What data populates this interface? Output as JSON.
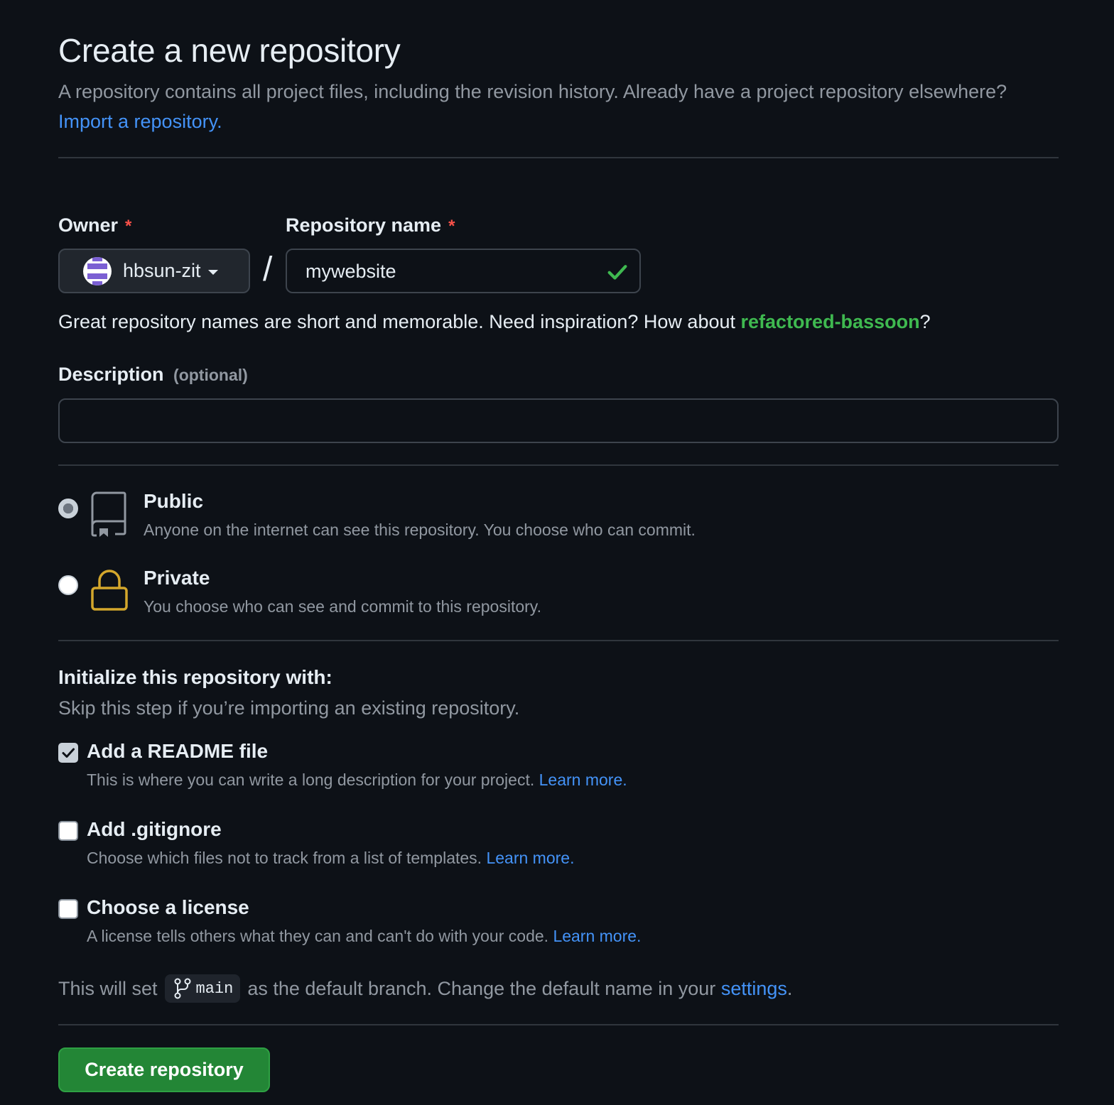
{
  "header": {
    "title": "Create a new repository",
    "intro": "A repository contains all project files, including the revision history. Already have a project repository elsewhere?",
    "import_link": "Import a repository."
  },
  "owner": {
    "label": "Owner",
    "required_mark": "*",
    "value": "hbsun-zit"
  },
  "repo_name": {
    "label": "Repository name",
    "required_mark": "*",
    "separator": "/",
    "value": "mywebsite",
    "hint_prefix": "Great repository names are short and memorable. Need inspiration? How about",
    "suggestion": "refactored-bassoon",
    "hint_suffix": "?"
  },
  "description": {
    "label": "Description",
    "optional": "(optional)",
    "value": ""
  },
  "visibility": {
    "public": {
      "title": "Public",
      "desc": "Anyone on the internet can see this repository. You choose who can commit.",
      "selected": true
    },
    "private": {
      "title": "Private",
      "desc": "You choose who can see and commit to this repository.",
      "selected": false
    }
  },
  "initialize": {
    "title": "Initialize this repository with:",
    "subtitle": "Skip this step if you’re importing an existing repository.",
    "readme": {
      "title": "Add a README file",
      "desc": "This is where you can write a long description for your project.",
      "link": "Learn more.",
      "checked": true
    },
    "gitignore": {
      "title": "Add .gitignore",
      "desc": "Choose which files not to track from a list of templates.",
      "link": "Learn more.",
      "checked": false
    },
    "license": {
      "title": "Choose a license",
      "desc": "A license tells others what they can and can't do with your code.",
      "link": "Learn more.",
      "checked": false
    }
  },
  "branch": {
    "prefix": "This will set",
    "name": "main",
    "middle": "as the default branch. Change the default name in your",
    "settings_link": "settings",
    "suffix": "."
  },
  "submit": {
    "label": "Create repository"
  },
  "colors": {
    "background": "#0d1117",
    "link": "#4493f8",
    "success": "#3fb950",
    "primary_button": "#238636",
    "required": "#f85149",
    "lock_icon": "#d4a72c"
  }
}
